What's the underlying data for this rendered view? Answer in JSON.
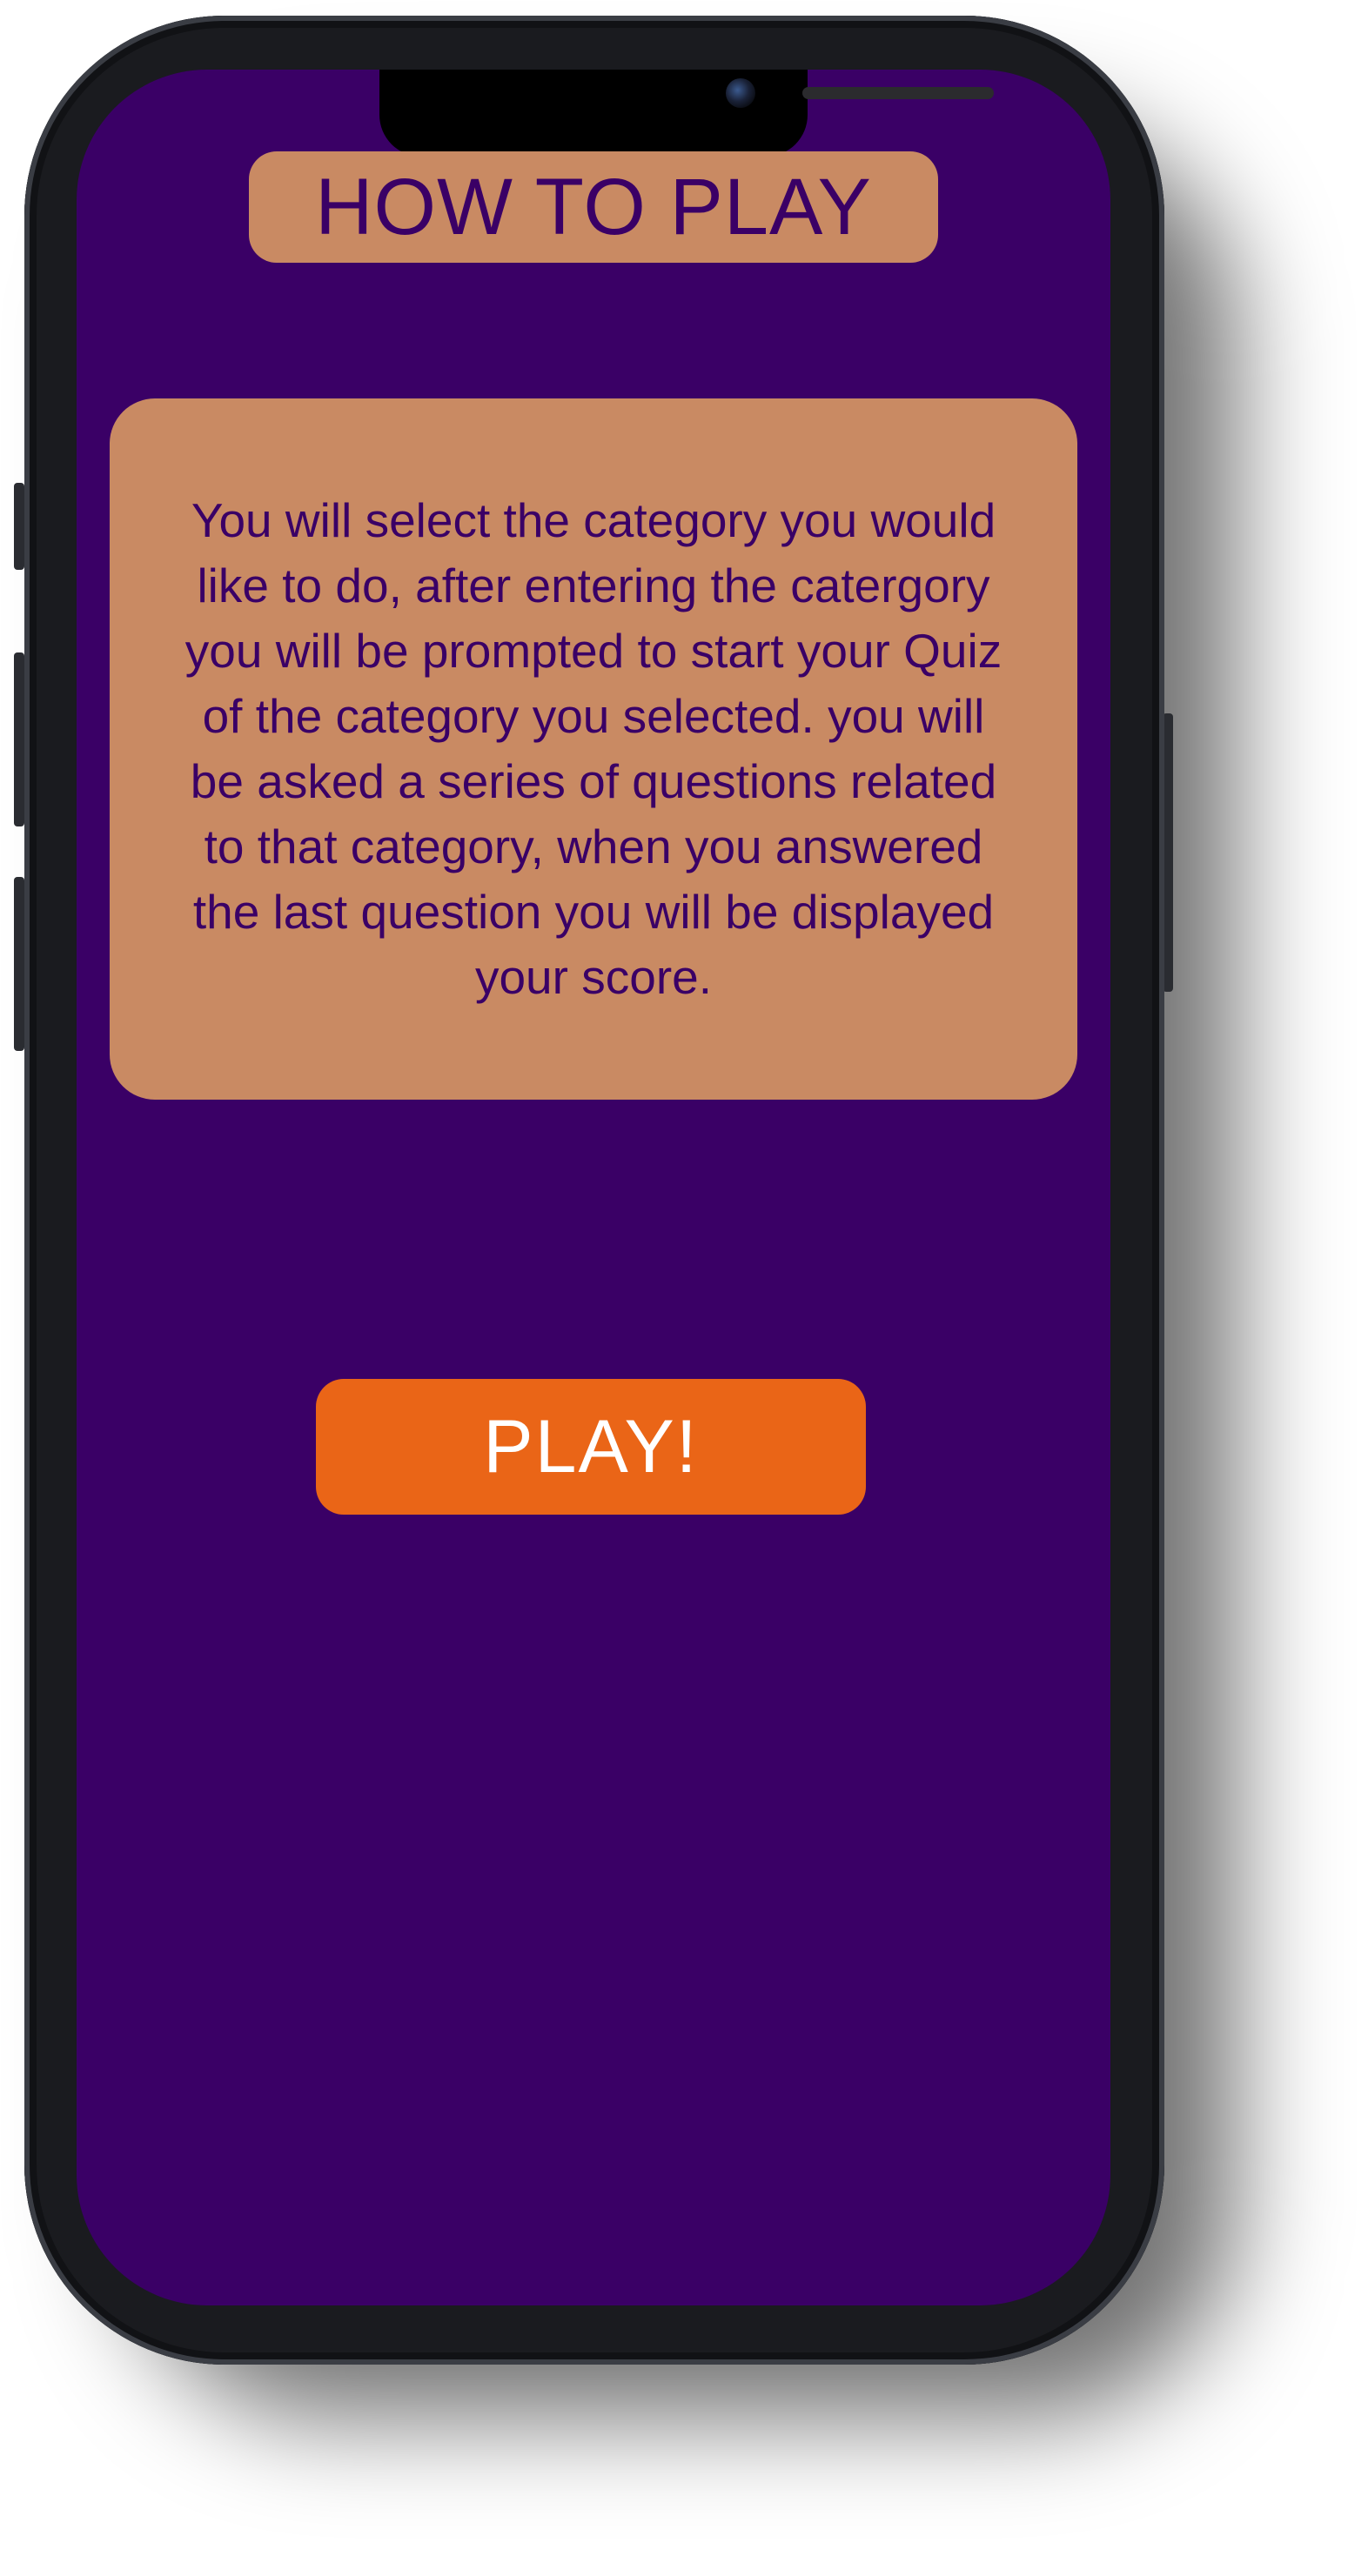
{
  "screen": {
    "title": "HOW TO PLAY",
    "instructions": "You will select the category you would like to do, after entering the catergory you will be prompted to start your Quiz of the category you selected. you will be asked a series of questions related to that category, when you answered the last question you will be displayed your score.",
    "play_label": "PLAY!"
  },
  "colors": {
    "background": "#3a0066",
    "card": "#c98a63",
    "accent": "#ea6517",
    "text_dark": "#3a0066",
    "text_light": "#ffffff"
  }
}
